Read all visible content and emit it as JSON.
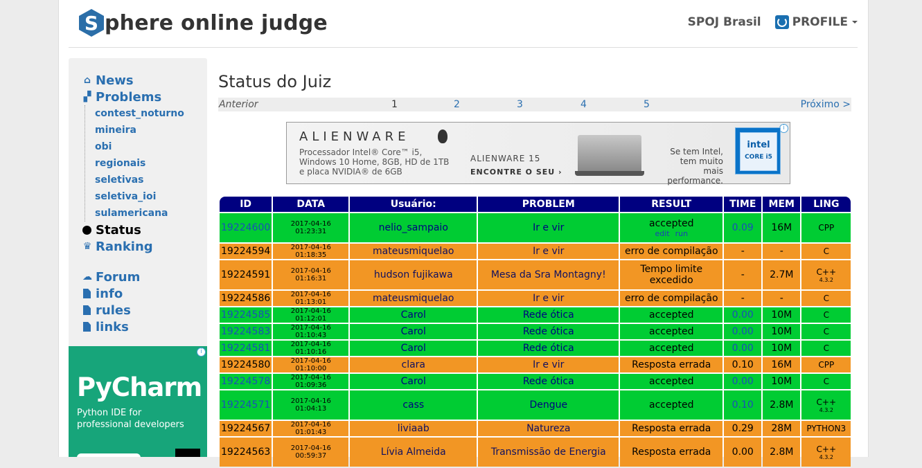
{
  "header": {
    "logo_letter": "S",
    "logo_text": "phere online judge",
    "brasil": "SPOJ Brasil",
    "profile": "PROFILE"
  },
  "sidebar": {
    "news": "News",
    "problems": "Problems",
    "sub_items": [
      "contest_noturno",
      "mineira",
      "obi",
      "regionais",
      "seletivas",
      "seletiva_ioi",
      "sulamericana"
    ],
    "status": "Status",
    "ranking": "Ranking",
    "forum": "Forum",
    "info": "info",
    "rules": "rules",
    "links": "links"
  },
  "side_ad": {
    "title": "PyCharm",
    "line1": "Python IDE for",
    "line2": "professional developers"
  },
  "main": {
    "title": "Status do Juiz",
    "pager": {
      "prev": "Anterior",
      "pages": [
        "1",
        "2",
        "3",
        "4",
        "5"
      ],
      "next": "Próximo >"
    }
  },
  "banner_ad": {
    "brand": "ALIENWARE",
    "spec1": "Processador Intel® Core™ i5,",
    "spec2": "Windows 10 Home, 8GB, HD de 1TB",
    "spec3": "e placa NVIDIA® de 6GB",
    "model": "ALIENWARE 15",
    "cta": "ENCONTRE O SEU ›",
    "intel1": "Se tem Intel,",
    "intel2": "tem muito mais",
    "intel3": "performance.",
    "intel_logo": "intel",
    "intel_core": "CORE i5"
  },
  "table": {
    "headers": [
      "ID",
      "DATA",
      "Usuário:",
      "PROBLEM",
      "RESULT",
      "TIME",
      "MEM",
      "LING"
    ],
    "edit": "edit",
    "run": "run",
    "rows": [
      {
        "id": "19224600",
        "date": "2017-04-16 01:23:31",
        "user": "nelio_sampaio",
        "problem": "Ir e vir",
        "result": "accepted",
        "time": "0.09",
        "mem": "16M",
        "ling": "CPP",
        "ling_sub": "",
        "status": "g",
        "links": true
      },
      {
        "id": "19224594",
        "date": "2017-04-16 01:18:35",
        "user": "mateusmiquelao",
        "problem": "Ir e vir",
        "result": "erro de compilação",
        "time": "-",
        "mem": "-",
        "ling": "C",
        "ling_sub": "",
        "status": "o",
        "links": false
      },
      {
        "id": "19224591",
        "date": "2017-04-16 01:16:31",
        "user": "hudson fujikawa",
        "problem": "Mesa da Sra Montagny!",
        "result": "Tempo limite excedido",
        "time": "-",
        "mem": "2.7M",
        "ling": "C++",
        "ling_sub": "4.3.2",
        "status": "o",
        "links": false
      },
      {
        "id": "19224586",
        "date": "2017-04-16 01:13:01",
        "user": "mateusmiquelao",
        "problem": "Ir e vir",
        "result": "erro de compilação",
        "time": "-",
        "mem": "-",
        "ling": "C",
        "ling_sub": "",
        "status": "o",
        "links": false
      },
      {
        "id": "19224585",
        "date": "2017-04-16 01:12:01",
        "user": "Carol",
        "problem": "Rede ótica",
        "result": "accepted",
        "time": "0.00",
        "mem": "10M",
        "ling": "C",
        "ling_sub": "",
        "status": "g",
        "links": false
      },
      {
        "id": "19224583",
        "date": "2017-04-16 01:10:43",
        "user": "Carol",
        "problem": "Rede ótica",
        "result": "accepted",
        "time": "0.00",
        "mem": "10M",
        "ling": "C",
        "ling_sub": "",
        "status": "g",
        "links": false
      },
      {
        "id": "19224581",
        "date": "2017-04-16 01:10:16",
        "user": "Carol",
        "problem": "Rede ótica",
        "result": "accepted",
        "time": "0.00",
        "mem": "10M",
        "ling": "C",
        "ling_sub": "",
        "status": "g",
        "links": false
      },
      {
        "id": "19224580",
        "date": "2017-04-16 01:10:00",
        "user": "clara",
        "problem": "Ir e vir",
        "result": "Resposta errada",
        "time": "0.10",
        "mem": "16M",
        "ling": "CPP",
        "ling_sub": "",
        "status": "o",
        "links": false
      },
      {
        "id": "19224578",
        "date": "2017-04-16 01:09:36",
        "user": "Carol",
        "problem": "Rede ótica",
        "result": "accepted",
        "time": "0.00",
        "mem": "10M",
        "ling": "C",
        "ling_sub": "",
        "status": "g",
        "links": false
      },
      {
        "id": "19224571",
        "date": "2017-04-16 01:04:13",
        "user": "cass",
        "problem": "Dengue",
        "result": "accepted",
        "time": "0.10",
        "mem": "2.8M",
        "ling": "C++",
        "ling_sub": "4.3.2",
        "status": "g",
        "links": false
      },
      {
        "id": "19224567",
        "date": "2017-04-16 01:01:43",
        "user": "liviaab",
        "problem": "Natureza",
        "result": "Resposta errada",
        "time": "0.29",
        "mem": "28M",
        "ling": "PYTHON3",
        "ling_sub": "",
        "status": "o",
        "links": false
      },
      {
        "id": "19224563",
        "date": "2017-04-16 00:59:37",
        "user": "Lívia Almeida",
        "problem": "Transmissão de Energia",
        "result": "Resposta errada",
        "time": "0.00",
        "mem": "2.8M",
        "ling": "C++",
        "ling_sub": "4.3.2",
        "status": "o",
        "links": false
      }
    ]
  },
  "colors": {
    "accepted": "#00cc33",
    "error": "#f29624",
    "header": "#000080",
    "link": "#2a6fb0"
  }
}
